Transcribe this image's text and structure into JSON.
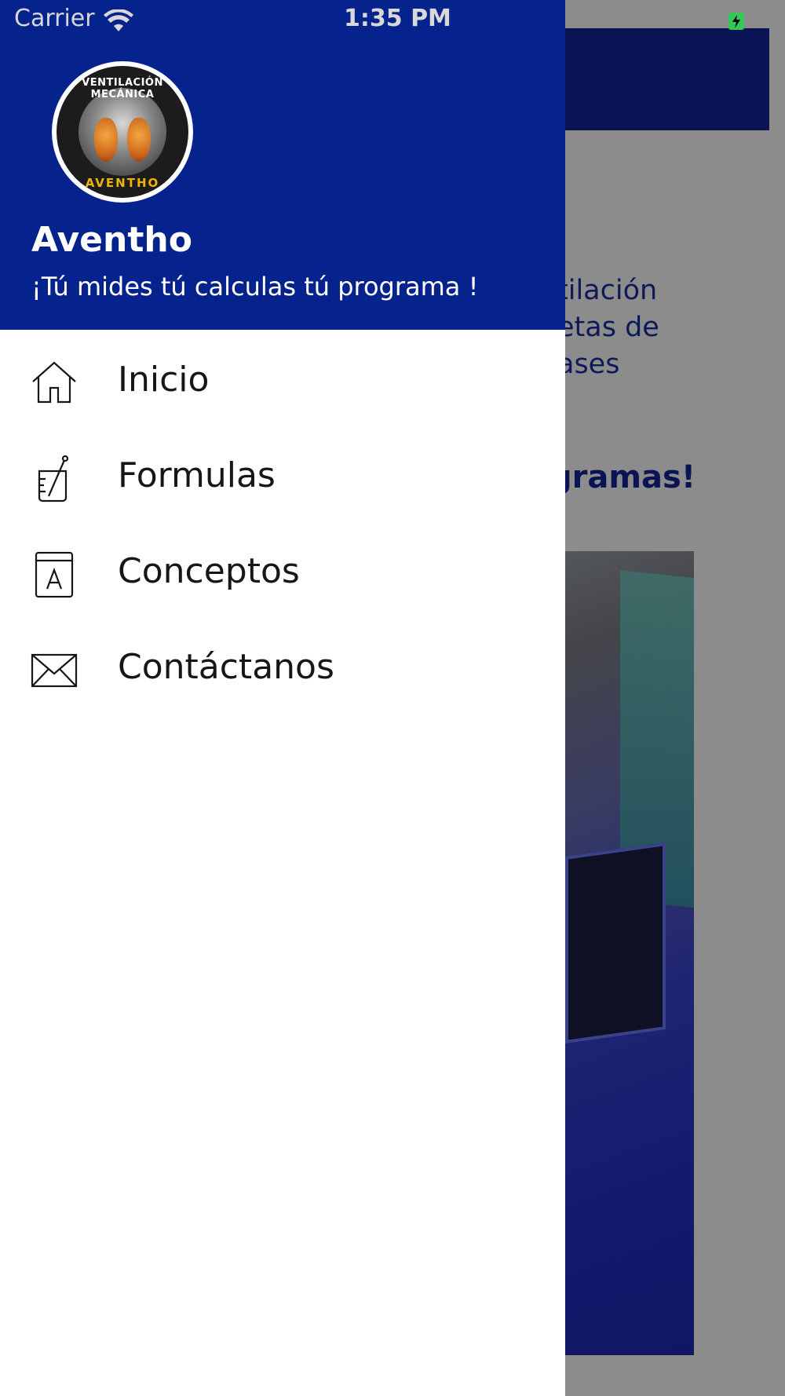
{
  "status_bar": {
    "carrier": "Carrier",
    "time": "1:35 PM"
  },
  "drawer": {
    "app_name": "Aventho",
    "tagline": "¡Tú mides tú calculas tú programa !",
    "logo": {
      "top_text": "VENTILACIÓN MECÁNICA",
      "bottom_text": "AVENTHO"
    },
    "menu": [
      {
        "label": "Inicio",
        "icon": "home-icon"
      },
      {
        "label": "Formulas",
        "icon": "beaker-icon"
      },
      {
        "label": "Conceptos",
        "icon": "book-icon"
      },
      {
        "label": "Contáctanos",
        "icon": "mail-icon"
      }
    ]
  },
  "background_screen": {
    "text_lines": [
      "tilación",
      "etas de",
      "ases"
    ],
    "heading": "gramas!"
  },
  "colors": {
    "header_blue": "#06228c",
    "navbar_blue": "#13239a",
    "menu_text": "#161616"
  }
}
